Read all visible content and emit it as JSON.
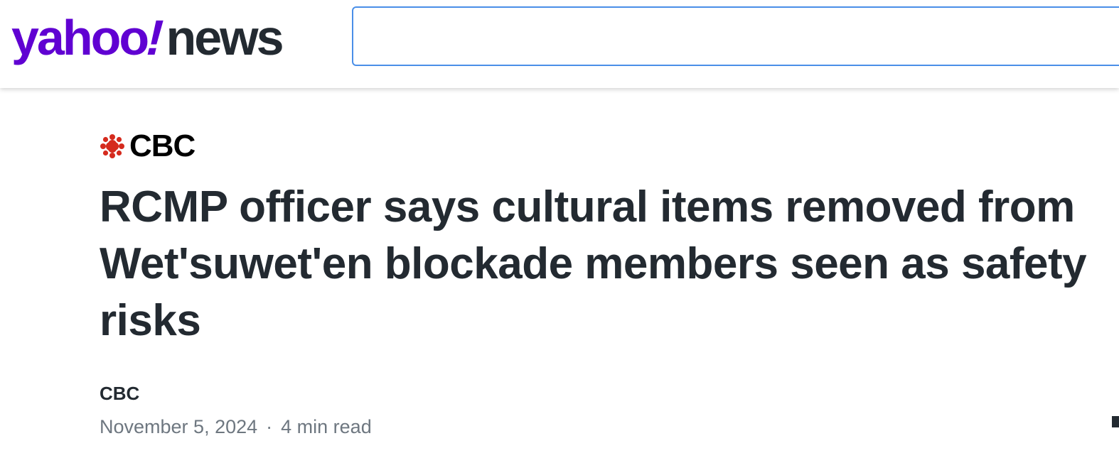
{
  "header": {
    "logo_yahoo": "yahoo",
    "logo_bang": "!",
    "logo_news": "news",
    "search": {
      "value": "",
      "placeholder": ""
    }
  },
  "article": {
    "publisher_logo_text": "CBC",
    "headline": "RCMP officer says cultural items removed from Wet'suwet'en blockade members seen as safety risks",
    "author": "CBC",
    "date": "November 5, 2024",
    "separator": "·",
    "read_time": "4 min read"
  },
  "colors": {
    "yahoo_purple": "#6001d2",
    "text_dark": "#232a31",
    "text_muted": "#6e7780",
    "search_border": "#4a8fe8",
    "cbc_red": "#d52b1e"
  },
  "icons": {
    "publisher_icon": "cbc-gem-icon"
  }
}
